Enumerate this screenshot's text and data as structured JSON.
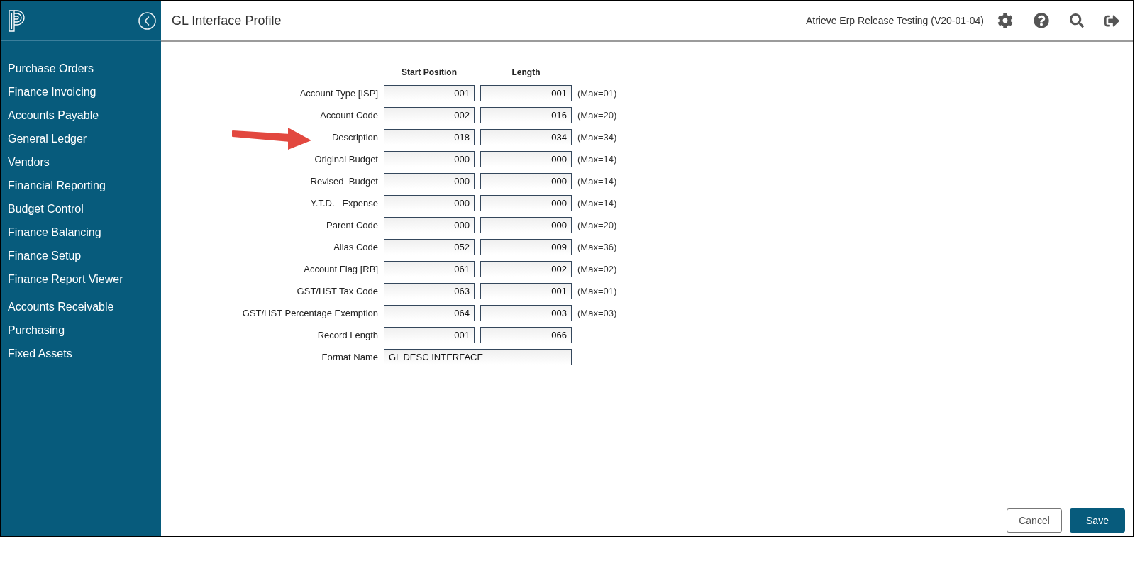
{
  "sidebar": {
    "sections": [
      {
        "items": [
          {
            "label": "Purchase Orders"
          },
          {
            "label": "Finance Invoicing"
          },
          {
            "label": "Accounts Payable"
          },
          {
            "label": "General Ledger"
          },
          {
            "label": "Vendors"
          },
          {
            "label": "Financial Reporting"
          },
          {
            "label": "Budget Control"
          },
          {
            "label": "Finance Balancing"
          },
          {
            "label": "Finance Setup"
          },
          {
            "label": "Finance Report Viewer"
          }
        ]
      },
      {
        "items": [
          {
            "label": "Accounts Receivable"
          },
          {
            "label": "Purchasing"
          },
          {
            "label": "Fixed Assets"
          }
        ]
      }
    ]
  },
  "header": {
    "title": "GL Interface Profile",
    "environment": "Atrieve Erp Release Testing (V20-01-04)"
  },
  "form": {
    "columns": [
      "Start Position",
      "Length"
    ],
    "rows": [
      {
        "kind": "pair",
        "label": "Account Type [ISP]",
        "start": "001",
        "length": "001",
        "max": "(Max=01)"
      },
      {
        "kind": "pair",
        "label": "Account Code",
        "start": "002",
        "length": "016",
        "max": "(Max=20)"
      },
      {
        "kind": "pair",
        "label": "Description",
        "start": "018",
        "length": "034",
        "max": "(Max=34)"
      },
      {
        "kind": "pair",
        "label": "Original Budget",
        "start": "000",
        "length": "000",
        "max": "(Max=14)"
      },
      {
        "kind": "pair",
        "label": "Revised  Budget",
        "start": "000",
        "length": "000",
        "max": "(Max=14)"
      },
      {
        "kind": "pair",
        "label": "Y.T.D.   Expense",
        "start": "000",
        "length": "000",
        "max": "(Max=14)"
      },
      {
        "kind": "pair",
        "label": "Parent Code",
        "start": "000",
        "length": "000",
        "max": "(Max=20)"
      },
      {
        "kind": "pair",
        "label": "Alias Code",
        "start": "052",
        "length": "009",
        "max": "(Max=36)"
      },
      {
        "kind": "pair",
        "label": "Account Flag [RB]",
        "start": "061",
        "length": "002",
        "max": "(Max=02)"
      },
      {
        "kind": "pair",
        "label": "GST/HST Tax Code",
        "start": "063",
        "length": "001",
        "max": "(Max=01)"
      },
      {
        "kind": "pair",
        "label": "GST/HST Percentage Exemption",
        "start": "064",
        "length": "003",
        "max": "(Max=03)"
      },
      {
        "kind": "pair",
        "label": "Record Length",
        "start": "001",
        "length": "066"
      },
      {
        "kind": "text",
        "label": "Format Name",
        "value": "GL DESC INTERFACE"
      }
    ]
  },
  "footer": {
    "buttons": [
      {
        "label": "Cancel",
        "kind": "secondary"
      },
      {
        "label": "Save",
        "kind": "primary"
      }
    ]
  }
}
